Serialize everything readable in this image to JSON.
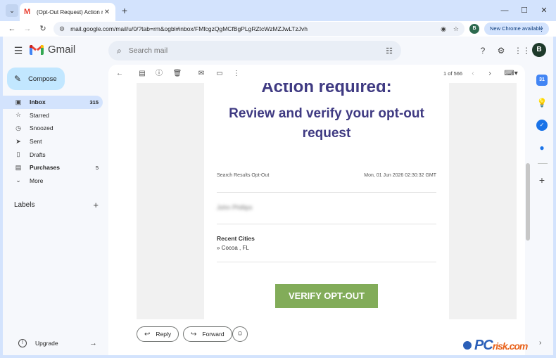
{
  "browser": {
    "tab_title": "(Opt-Out Request) Action requ",
    "tab_close": "✕",
    "new_tab": "+",
    "tab_list": "⌄",
    "url": "mail.google.com/mail/u/0/?tab=rm&ogbl#inbox/FMfcgzQgMCfBgPLgRZtcWzMZJwLTzJvh",
    "profile_initial": "B",
    "new_chrome_label": "New Chrome available",
    "controls": {
      "minimize": "—",
      "maximize": "☐",
      "close": "✕"
    }
  },
  "gmail": {
    "product_name": "Gmail",
    "search": {
      "placeholder": "Search mail"
    },
    "account_initial": "B",
    "compose_label": "Compose",
    "nav": [
      {
        "label": "Inbox",
        "count": "315",
        "icon": "inbox-icon"
      },
      {
        "label": "Starred",
        "count": "",
        "icon": "star-icon"
      },
      {
        "label": "Snoozed",
        "count": "",
        "icon": "clock-icon"
      },
      {
        "label": "Sent",
        "count": "",
        "icon": "send-icon"
      },
      {
        "label": "Drafts",
        "count": "",
        "icon": "draft-icon"
      },
      {
        "label": "Purchases",
        "count": "5",
        "icon": "purchases-icon"
      },
      {
        "label": "More",
        "count": "",
        "icon": "chevron-down-icon"
      }
    ],
    "labels_title": "Labels",
    "upgrade_label": "Upgrade",
    "pager": "1 of 566"
  },
  "email": {
    "heading_partial": "Action required:",
    "heading": "Review and verify your opt-out request",
    "sender": "Search Results Opt-Out",
    "date": "Mon, 01 Jun 2026 02:30:32 GMT",
    "name_blurred": "John Phillips",
    "cities_title": "Recent Cities",
    "cities_value": "» Cocoa , FL",
    "verify_button": "VERIFY OPT-OUT"
  },
  "reply_bar": {
    "reply_label": "Reply",
    "forward_label": "Forward"
  },
  "side_panel": {
    "calendar_label": "31"
  },
  "watermark": {
    "main": "PC",
    "suffix": "risk.com"
  },
  "colors": {
    "heading": "#3f3a82",
    "verify_button": "#82ac59",
    "compose_bg": "#c2e7ff",
    "active_nav": "#d3e3fd"
  }
}
